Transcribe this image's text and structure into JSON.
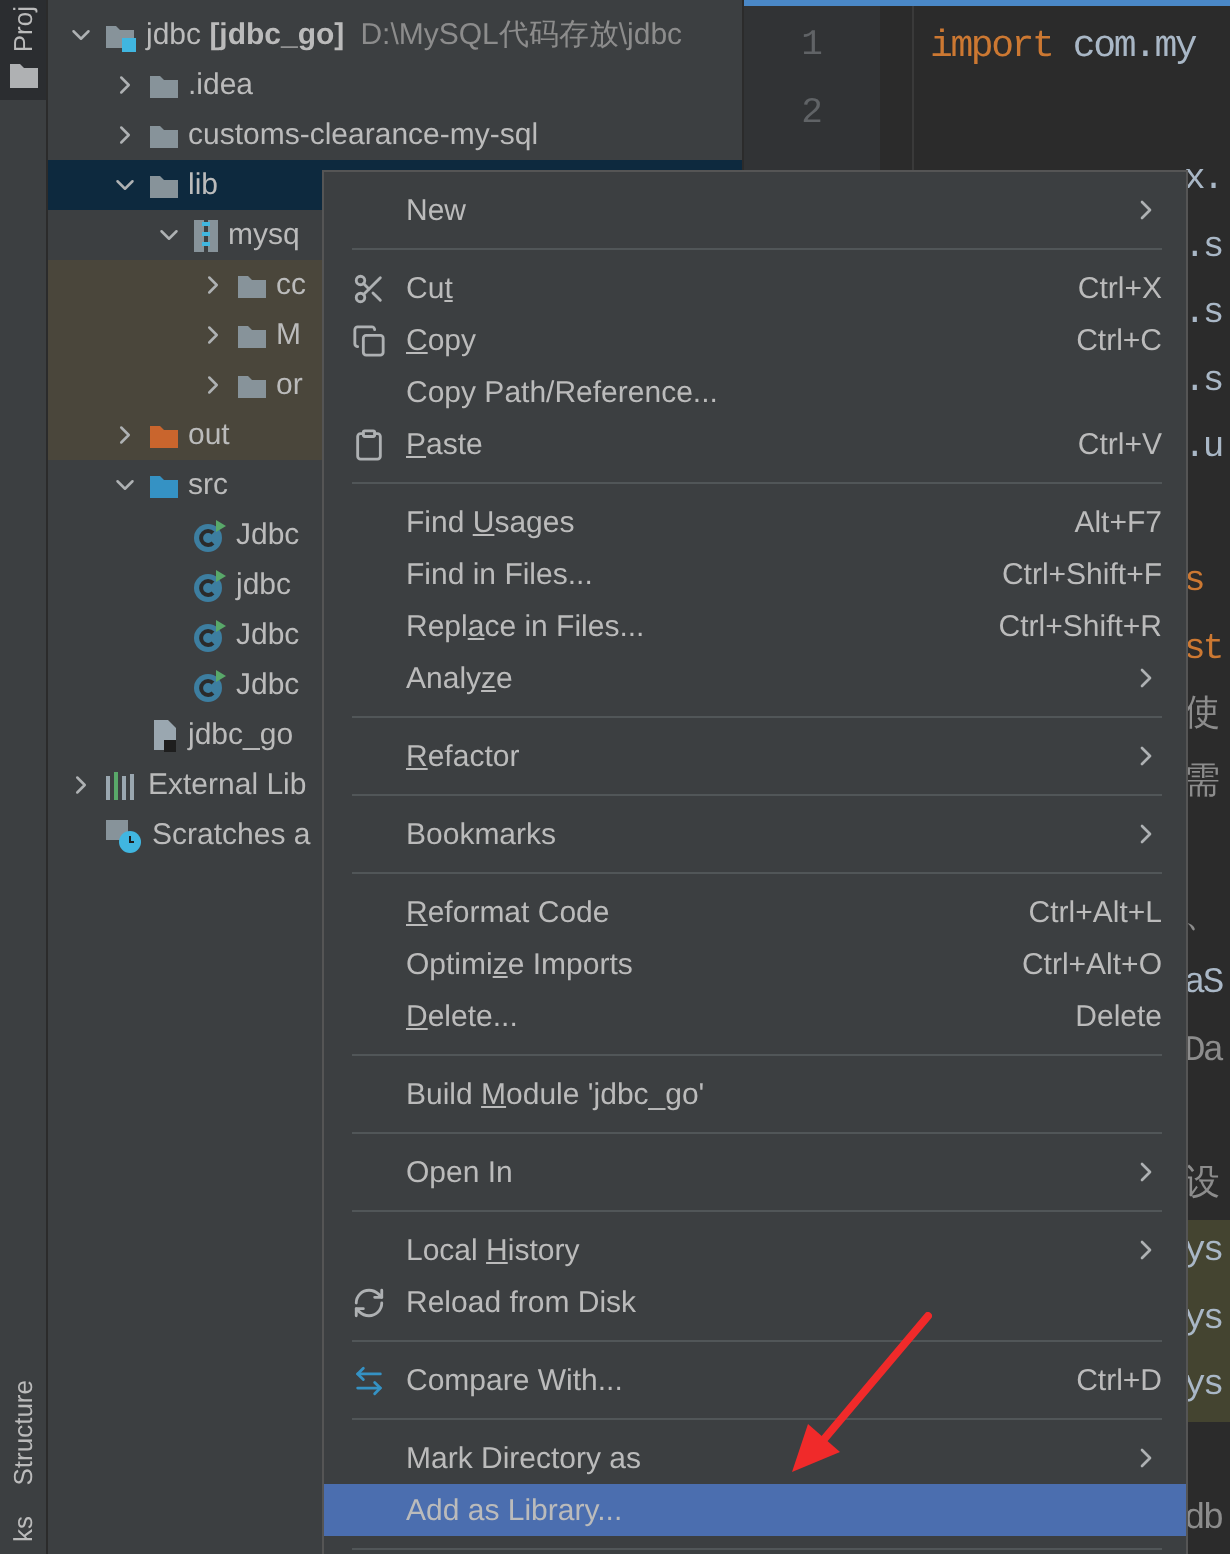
{
  "tool_strip": {
    "top": [
      {
        "label": "Proj",
        "selected": true
      }
    ],
    "bottom": [
      {
        "label": "Structure",
        "selected": false
      },
      {
        "label": "ks",
        "selected": false
      }
    ]
  },
  "project_tree": {
    "items": [
      {
        "label": "jdbc **[jdbc_go]**",
        "path": "D:\\MySQL代码存放\\jdbc",
        "kind": "module",
        "expanded": true,
        "selected": false,
        "tinted": false,
        "children": [
          {
            "label": ".idea",
            "kind": "folder",
            "expanded": false,
            "selected": false,
            "tinted": false
          },
          {
            "label": "customs-clearance-my-sql",
            "kind": "folder",
            "expanded": false,
            "selected": false,
            "tinted": false
          },
          {
            "label": "lib",
            "kind": "folder",
            "expanded": true,
            "selected": true,
            "tinted": false,
            "children": [
              {
                "label": "mysq",
                "kind": "jar",
                "expanded": true,
                "selected": false,
                "tinted": false,
                "children": [
                  {
                    "label": "cc",
                    "kind": "folder",
                    "expanded": false,
                    "selected": false,
                    "tinted": true
                  },
                  {
                    "label": "M",
                    "kind": "folder",
                    "expanded": false,
                    "selected": false,
                    "tinted": true
                  },
                  {
                    "label": "or",
                    "kind": "folder",
                    "expanded": false,
                    "selected": false,
                    "tinted": true
                  }
                ]
              }
            ]
          },
          {
            "label": "out",
            "kind": "excluded",
            "expanded": false,
            "selected": false,
            "tinted": true
          },
          {
            "label": "src",
            "kind": "source",
            "expanded": true,
            "selected": false,
            "tinted": false,
            "children": [
              {
                "label": "Jdbc",
                "kind": "class",
                "selected": false,
                "tinted": false
              },
              {
                "label": "jdbc",
                "kind": "class",
                "selected": false,
                "tinted": false
              },
              {
                "label": "Jdbc",
                "kind": "class",
                "selected": false,
                "tinted": false
              },
              {
                "label": "Jdbc",
                "kind": "class",
                "selected": false,
                "tinted": false
              }
            ]
          },
          {
            "label": "jdbc_go",
            "kind": "file",
            "selected": false,
            "tinted": false
          }
        ]
      },
      {
        "label": "External Lib",
        "kind": "libraries",
        "expanded": false,
        "selected": false,
        "tinted": false
      },
      {
        "label": "Scratches a",
        "kind": "scratches",
        "selected": false,
        "tinted": false
      }
    ]
  },
  "editor": {
    "line_numbers": [
      "1",
      "2"
    ],
    "blocks": [
      {
        "lines": [
          {
            "highlighted": false,
            "tokens": [
              {
                "text": "import",
                "kind": "keyword"
              },
              {
                "text": " com.my",
                "kind": "plain"
              }
            ]
          }
        ]
      },
      {
        "lines": [
          {
            "highlighted": false,
            "tokens": [
              {
                "text": "x.",
                "kind": "plain"
              }
            ]
          },
          {
            "highlighted": false,
            "tokens": [
              {
                "text": ".s",
                "kind": "plain"
              }
            ]
          },
          {
            "highlighted": false,
            "tokens": [
              {
                "text": ".s",
                "kind": "plain"
              }
            ]
          },
          {
            "highlighted": false,
            "tokens": [
              {
                "text": ".s",
                "kind": "plain"
              }
            ]
          },
          {
            "highlighted": false,
            "tokens": [
              {
                "text": ".u",
                "kind": "plain"
              }
            ]
          }
        ]
      },
      {
        "lines": [
          {
            "highlighted": false,
            "tokens": [
              {
                "text": "s",
                "kind": "keyword"
              }
            ]
          },
          {
            "highlighted": false,
            "tokens": [
              {
                "text": "st",
                "kind": "keyword"
              }
            ]
          },
          {
            "highlighted": false,
            "tokens": [
              {
                "text": "使",
                "kind": "comment"
              }
            ]
          },
          {
            "highlighted": false,
            "tokens": [
              {
                "text": "需",
                "kind": "comment"
              }
            ]
          }
        ]
      },
      {
        "lines": [
          {
            "highlighted": false,
            "tokens": [
              {
                "text": "、",
                "kind": "comment"
              }
            ]
          },
          {
            "highlighted": false,
            "tokens": [
              {
                "text": "aS",
                "kind": "plain"
              }
            ]
          },
          {
            "highlighted": false,
            "tokens": [
              {
                "text": "Da",
                "kind": "comment"
              }
            ]
          }
        ]
      },
      {
        "lines": [
          {
            "highlighted": false,
            "tokens": [
              {
                "text": "设",
                "kind": "comment"
              }
            ]
          },
          {
            "highlighted": true,
            "tokens": [
              {
                "text": "ys",
                "kind": "plain"
              }
            ]
          },
          {
            "highlighted": true,
            "tokens": [
              {
                "text": "ys",
                "kind": "plain"
              }
            ]
          },
          {
            "highlighted": true,
            "tokens": [
              {
                "text": "ys",
                "kind": "plain"
              }
            ]
          }
        ]
      },
      {
        "lines": [
          {
            "highlighted": false,
            "tokens": [
              {
                "text": "db",
                "kind": "comment"
              }
            ]
          }
        ]
      }
    ]
  },
  "context_menu": {
    "groups": [
      {
        "items": [
          {
            "label": "New",
            "kind": "plain",
            "submenu": true,
            "selected": false
          }
        ]
      },
      {
        "items": [
          {
            "label": {
              "before": "Cu",
              "key": "t"
            },
            "kind": "cut",
            "shortcut": "Ctrl+X",
            "submenu": false,
            "selected": false
          },
          {
            "label": {
              "key": "C",
              "after": "opy"
            },
            "kind": "copy",
            "shortcut": "Ctrl+C",
            "submenu": false,
            "selected": false
          },
          {
            "label": "Copy Path/Reference...",
            "kind": "plain",
            "submenu": false,
            "selected": false
          },
          {
            "label": {
              "key": "P",
              "after": "aste"
            },
            "kind": "paste",
            "shortcut": "Ctrl+V",
            "submenu": false,
            "selected": false
          }
        ]
      },
      {
        "items": [
          {
            "label": {
              "before": "Find ",
              "key": "U",
              "after": "sages"
            },
            "kind": "plain",
            "shortcut": "Alt+F7",
            "submenu": false,
            "selected": false
          },
          {
            "label": "Find in Files...",
            "kind": "plain",
            "shortcut": "Ctrl+Shift+F",
            "submenu": false,
            "selected": false
          },
          {
            "label": {
              "before": "Repl",
              "key": "a",
              "after": "ce in Files..."
            },
            "kind": "plain",
            "shortcut": "Ctrl+Shift+R",
            "submenu": false,
            "selected": false
          },
          {
            "label": {
              "before": "Analy",
              "key": "z",
              "after": "e"
            },
            "kind": "plain",
            "submenu": true,
            "selected": false
          }
        ]
      },
      {
        "items": [
          {
            "label": {
              "key": "R",
              "after": "efactor"
            },
            "kind": "plain",
            "submenu": true,
            "selected": false
          }
        ]
      },
      {
        "items": [
          {
            "label": "Bookmarks",
            "kind": "plain",
            "submenu": true,
            "selected": false
          }
        ]
      },
      {
        "items": [
          {
            "label": {
              "key": "R",
              "after": "eformat Code"
            },
            "kind": "plain",
            "shortcut": "Ctrl+Alt+L",
            "submenu": false,
            "selected": false
          },
          {
            "label": {
              "before": "Optimi",
              "key": "z",
              "after": "e Imports"
            },
            "kind": "plain",
            "shortcut": "Ctrl+Alt+O",
            "submenu": false,
            "selected": false
          },
          {
            "label": {
              "key": "D",
              "after": "elete..."
            },
            "kind": "plain",
            "shortcut": "Delete",
            "submenu": false,
            "selected": false
          }
        ]
      },
      {
        "items": [
          {
            "label": {
              "before": "Build ",
              "key": "M",
              "after": "odule 'jdbc_go'"
            },
            "kind": "plain",
            "submenu": false,
            "selected": false
          }
        ]
      },
      {
        "items": [
          {
            "label": "Open In",
            "kind": "plain",
            "submenu": true,
            "selected": false
          }
        ]
      },
      {
        "items": [
          {
            "label": {
              "before": "Local ",
              "key": "H",
              "after": "istory"
            },
            "kind": "plain",
            "submenu": true,
            "selected": false
          },
          {
            "label": "Reload from Disk",
            "kind": "reload",
            "submenu": false,
            "selected": false
          }
        ]
      },
      {
        "items": [
          {
            "label": "Compare With...",
            "kind": "compare",
            "shortcut": "Ctrl+D",
            "submenu": false,
            "selected": false
          }
        ]
      },
      {
        "items": [
          {
            "label": "Mark Directory as",
            "kind": "plain",
            "submenu": true,
            "selected": false
          },
          {
            "label": "Add as Library...",
            "kind": "plain",
            "submenu": false,
            "selected": true
          }
        ]
      }
    ]
  }
}
